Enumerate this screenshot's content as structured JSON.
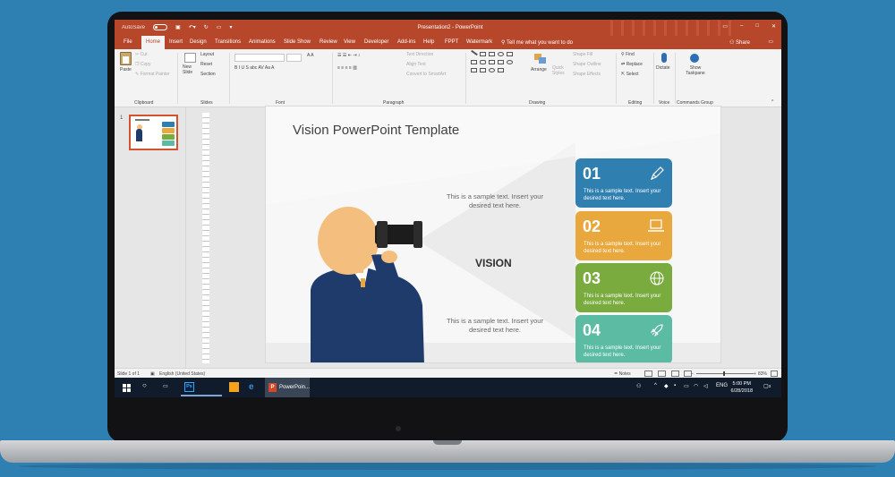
{
  "titlebar": {
    "autosave_label": "AutoSave",
    "autosave_state": "Off",
    "title": "Presentation2 - PowerPoint"
  },
  "tabs": [
    "File",
    "Home",
    "Insert",
    "Design",
    "Transitions",
    "Animations",
    "Slide Show",
    "Review",
    "View",
    "Developer",
    "Add-ins",
    "Help",
    "FPPT",
    "Watermark"
  ],
  "active_tab": "Home",
  "tell_me": "Tell me what you want to do",
  "share": "Share",
  "ribbon": {
    "clipboard": {
      "label": "Clipboard",
      "paste": "Paste",
      "cut": "Cut",
      "copy": "Copy",
      "format_painter": "Format Painter"
    },
    "slides": {
      "label": "Slides",
      "new_slide": "New Slide",
      "layout": "Layout",
      "reset": "Reset",
      "section": "Section"
    },
    "font": {
      "label": "Font"
    },
    "paragraph": {
      "label": "Paragraph",
      "text_direction": "Text Direction",
      "align_text": "Align Text",
      "convert_smartart": "Convert to SmartArt"
    },
    "drawing": {
      "label": "Drawing",
      "arrange": "Arrange",
      "quick_styles": "Quick Styles",
      "shape_fill": "Shape Fill",
      "shape_outline": "Shape Outline",
      "shape_effects": "Shape Effects"
    },
    "editing": {
      "label": "Editing",
      "find": "Find",
      "replace": "Replace",
      "select": "Select"
    },
    "voice": {
      "label": "Voice",
      "dictate": "Dictate"
    },
    "commands": {
      "label": "Commands Group",
      "show_taskpane": "Show Taskpane"
    }
  },
  "thumbnail": {
    "number": "1"
  },
  "slide": {
    "title": "Vision PowerPoint Template",
    "center_label": "VISION",
    "sample_top": "This is a sample text.  Insert your desired text here.",
    "sample_bottom": "This is a sample text.  Insert your desired text here.",
    "cards": [
      {
        "num": "01",
        "text": "This is a sample text.  Insert your desired text here.",
        "color": "#2f7fb0",
        "icon": "pencil-icon"
      },
      {
        "num": "02",
        "text": "This is a sample text.  Insert your desired text here.",
        "color": "#e9a83d",
        "icon": "laptop-icon"
      },
      {
        "num": "03",
        "text": "This is a sample text.  Insert your desired text here.",
        "color": "#7aab3e",
        "icon": "globe-icon"
      },
      {
        "num": "04",
        "text": "This is a sample text.  Insert your desired text here.",
        "color": "#5bbca3",
        "icon": "rocket-icon"
      }
    ]
  },
  "statusbar": {
    "slide_count": "Slide 1 of 1",
    "language": "English (United States)",
    "notes": "Notes",
    "zoom": "83%"
  },
  "taskbar": {
    "ppt_label": "PowerPoin...",
    "language": "ENG",
    "time": "5:00 PM",
    "date": "6/28/2018",
    "notification_count": "3"
  },
  "colors": {
    "accent": "#b7472a",
    "desktop": "#2e7fb2",
    "suit": "#1e3b6b",
    "skin": "#f4bf7e"
  }
}
